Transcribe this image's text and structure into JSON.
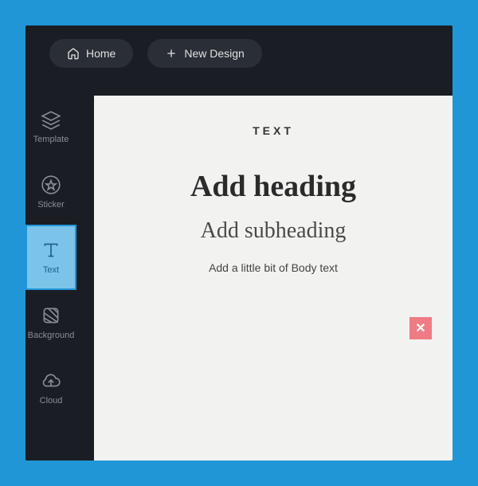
{
  "topbar": {
    "home_label": "Home",
    "new_design_label": "New Design"
  },
  "sidebar": {
    "items": [
      {
        "label": "Template",
        "active": false
      },
      {
        "label": "Sticker",
        "active": false
      },
      {
        "label": "Text",
        "active": true
      },
      {
        "label": "Background",
        "active": false
      },
      {
        "label": "Cloud",
        "active": false
      }
    ]
  },
  "panel": {
    "title": "TEXT",
    "heading_option": "Add heading",
    "subheading_option": "Add subheading",
    "body_option": "Add a little bit of Body text",
    "close_label": "✕"
  }
}
